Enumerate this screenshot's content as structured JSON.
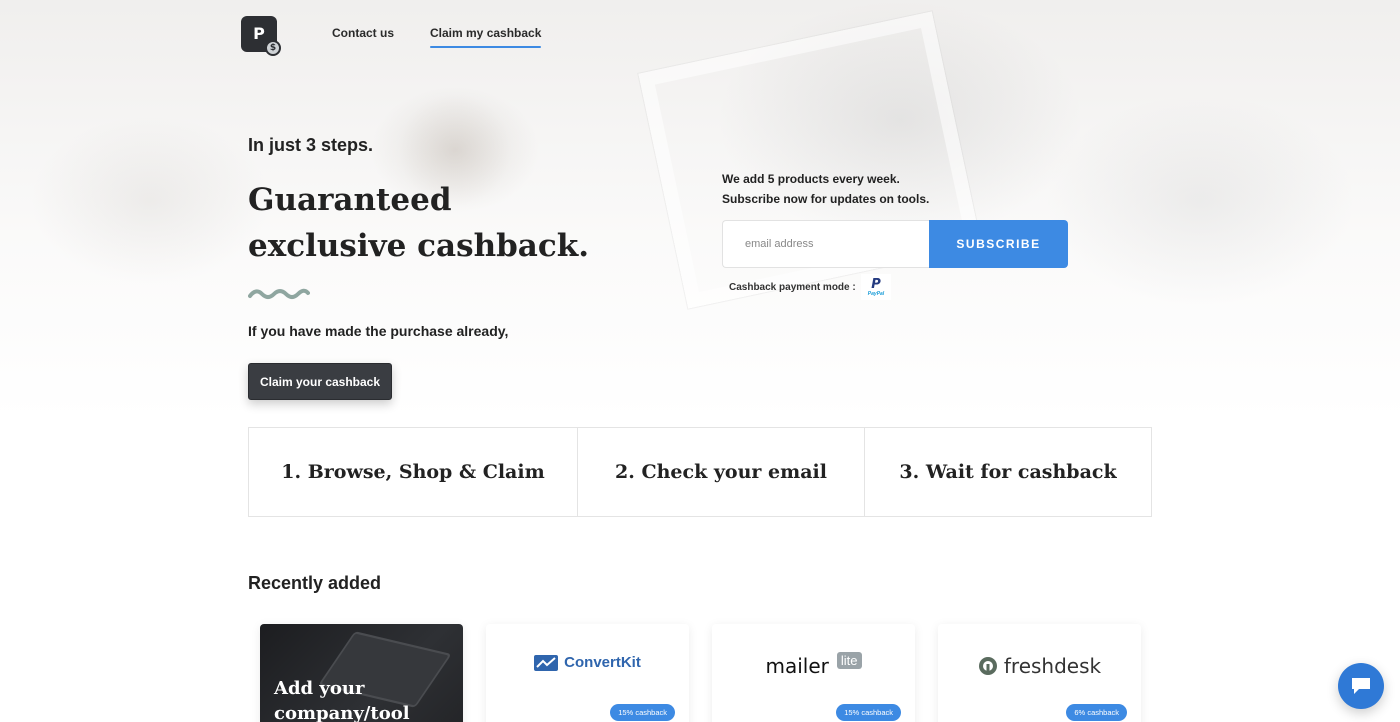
{
  "nav": {
    "logo_letter": "P",
    "logo_coin": "$",
    "links": [
      {
        "label": "Contact us"
      },
      {
        "label": "Claim my cashback"
      }
    ]
  },
  "hero": {
    "eyebrow": "In just 3 steps.",
    "headline_line1": "Guaranteed",
    "headline_line2": "exclusive cashback.",
    "already_text": "If you have made the purchase already,",
    "claim_button": "Claim your cashback"
  },
  "subscribe": {
    "line1": "We add 5 products every week.",
    "line2": "Subscribe now for updates on tools.",
    "email_placeholder": "email address",
    "button": "SUBSCRIBE",
    "payment_label": "Cashback payment mode :",
    "payment_logo_p": "P",
    "payment_logo_word": "PayPal"
  },
  "steps": [
    {
      "label": "1. Browse, Shop & Claim"
    },
    {
      "label": "2. Check your email"
    },
    {
      "label": "3. Wait for cashback"
    }
  ],
  "recent": {
    "title": "Recently added",
    "add_card_text": "Add your company/tool",
    "cards": [
      {
        "brand": "ConvertKit",
        "cashback": "15% cashback",
        "icon": "chart-icon"
      },
      {
        "brand": "mailer",
        "brand_badge": "lite",
        "cashback": "15% cashback"
      },
      {
        "brand": "freshdesk",
        "cashback": "6% cashback",
        "icon": "freshdesk-icon"
      }
    ]
  },
  "colors": {
    "accent": "#3d8ae3",
    "dark_button": "#3a3d42",
    "squiggle": "#8fa6a0"
  },
  "chat": {
    "icon": "chat-bubble-icon"
  }
}
